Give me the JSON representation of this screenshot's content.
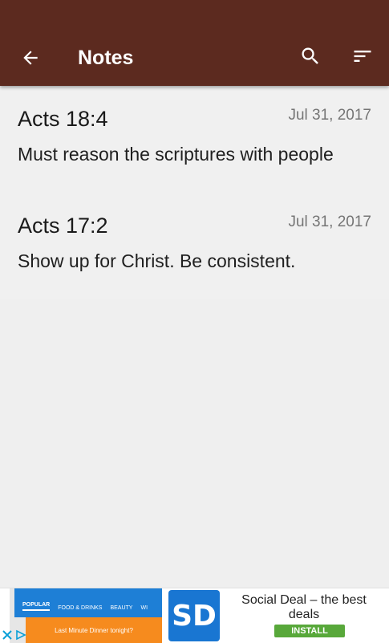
{
  "appbar": {
    "title": "Notes",
    "back_icon": "arrow-back-icon",
    "search_icon": "search-icon",
    "sort_icon": "sort-icon",
    "color": "#5c2a1f"
  },
  "notes": [
    {
      "reference": "Acts 18:4",
      "date": "Jul 31, 2017",
      "text": "Must reason the scriptures with people"
    },
    {
      "reference": "Acts 17:2",
      "date": "Jul 31, 2017",
      "text": "Show up for Christ. Be consistent."
    }
  ],
  "ad": {
    "tabs": [
      "POPULAR",
      "FOOD & DRINKS",
      "BEAUTY",
      "WI"
    ],
    "promo_text": "Last Minute Dinner tonight?",
    "logo_text": "SD",
    "headline": "Social Deal – the best deals",
    "install_label": "INSTALL"
  }
}
